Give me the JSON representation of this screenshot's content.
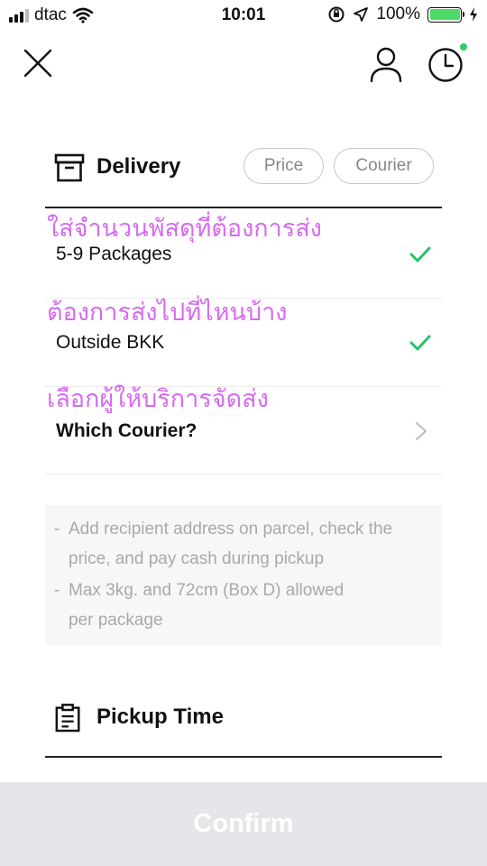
{
  "status_bar": {
    "carrier": "dtac",
    "time": "10:01",
    "battery": "100%"
  },
  "nav": {
    "close_icon": "close-icon",
    "user_icon": "user-icon",
    "history_icon": "clock-icon"
  },
  "delivery": {
    "title": "Delivery",
    "icon": "archive-box-icon",
    "pills": [
      "Price",
      "Courier"
    ]
  },
  "rows": [
    {
      "annotation": "ใส่จำนวนพัสดุที่ต้องการส่ง",
      "value": "5-9 Packages",
      "status": "check"
    },
    {
      "annotation": "ต้องการส่งไปที่ไหนบ้าง",
      "value": "Outside BKK",
      "status": "check"
    },
    {
      "annotation": "เลือกผู้ให้บริการจัดส่ง",
      "value": "Which Courier?",
      "status": "chevron"
    }
  ],
  "info": {
    "line1": "Add recipient address on parcel, check the",
    "line2": "price, and pay cash during pickup",
    "line3": "Max 3kg. and 72cm (Box D) allowed",
    "line4": "per package",
    "dash": "-"
  },
  "pickup": {
    "title": "Pickup Time",
    "icon": "clipboard-icon"
  },
  "confirm": {
    "label": "Confirm"
  },
  "colors": {
    "check": "#27c26a",
    "annotation": "#d66bf0",
    "notification_dot": "#2ecc71",
    "battery": "#4cd964",
    "confirm_bg": "#e5e5ea"
  }
}
